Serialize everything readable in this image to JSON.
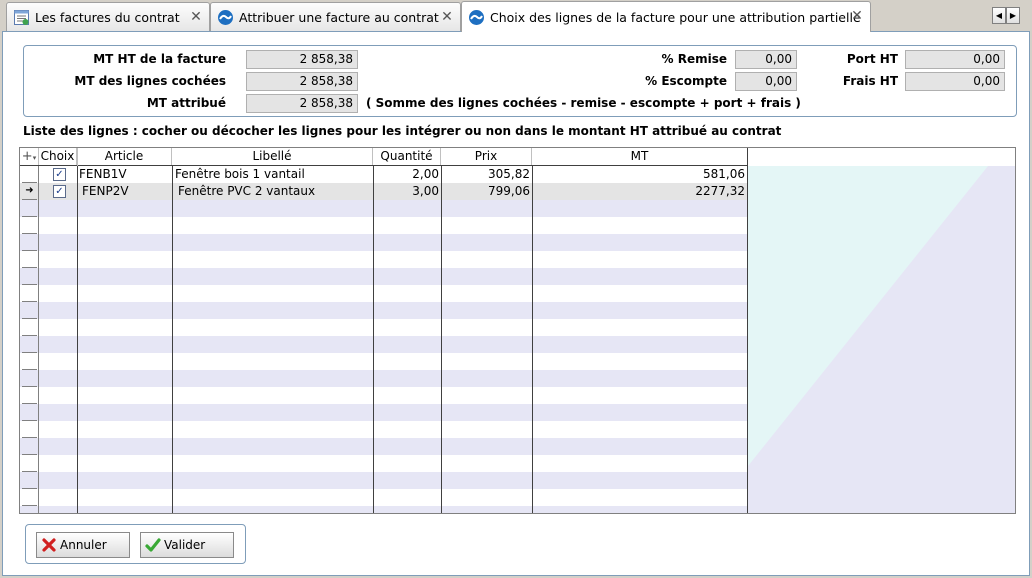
{
  "tabs": [
    {
      "label": "Les factures du contrat",
      "active": false
    },
    {
      "label": "Attribuer une facture au contrat",
      "active": false
    },
    {
      "label": "Choix des lignes de la facture pour une attribution partielle",
      "active": true
    }
  ],
  "summary": {
    "mt_ht_facture_label": "MT HT de la facture",
    "mt_ht_facture_value": "2 858,38",
    "mt_lignes_cochees_label": "MT des lignes cochées",
    "mt_lignes_cochees_value": "2 858,38",
    "mt_attribue_label": "MT attribué",
    "mt_attribue_value": "2 858,38",
    "formula_note": "( Somme des lignes cochées - remise - escompte + port + frais )",
    "remise_label": "% Remise",
    "remise_value": "0,00",
    "escompte_label": "% Escompte",
    "escompte_value": "0,00",
    "port_label": "Port HT",
    "port_value": "0,00",
    "frais_label": "Frais HT",
    "frais_value": "0,00"
  },
  "list_title": "Liste des lignes : cocher ou décocher les lignes pour les intégrer ou non dans le montant HT attribué au contrat",
  "grid": {
    "columns": [
      "Choix",
      "Article",
      "Libellé",
      "Quantité",
      "Prix",
      "MT"
    ],
    "rows": [
      {
        "checked": true,
        "article": "FENB1V",
        "libelle": "Fenêtre bois 1 vantail",
        "quantite": "2,00",
        "prix": "305,82",
        "mt": "581,06",
        "current": false
      },
      {
        "checked": true,
        "article": "FENP2V",
        "libelle": "Fenêtre PVC 2 vantaux",
        "quantite": "3,00",
        "prix": "799,06",
        "mt": "2277,32",
        "current": true
      }
    ]
  },
  "buttons": {
    "cancel_label": "Annuler",
    "validate_label": "Valider"
  },
  "icons": {
    "tab1": "invoice-list-icon",
    "tab2": "blue-wave-icon",
    "tab3": "blue-wave-icon",
    "cancel": "red-x-icon",
    "validate": "green-check-icon"
  },
  "colors": {
    "alt_row": "#e6e6f5",
    "selected_row": "#e4e4e4",
    "border_blue": "#7f9db9"
  }
}
